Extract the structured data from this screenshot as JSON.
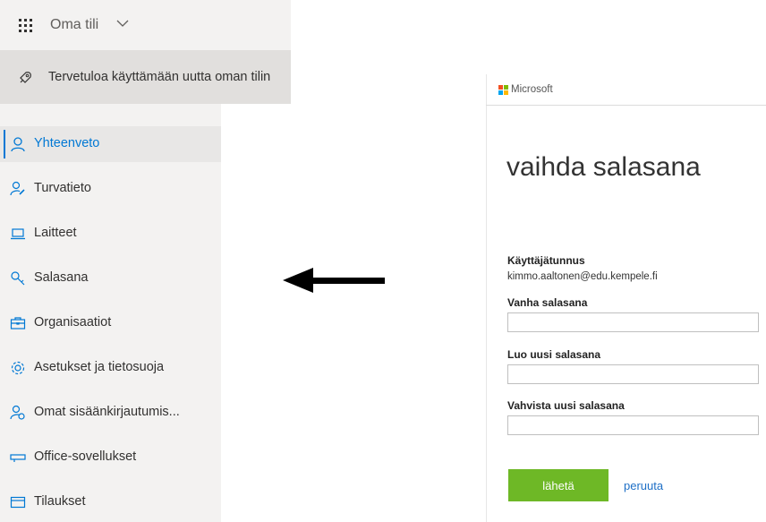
{
  "header": {
    "title": "Oma tili"
  },
  "banner": {
    "text": "Tervetuloa käyttämään uutta oman tilin"
  },
  "sidebar": {
    "items": [
      {
        "label": "Yhteenveto",
        "icon": "person-icon",
        "active": true
      },
      {
        "label": "Turvatieto",
        "icon": "person-key-icon"
      },
      {
        "label": "Laitteet",
        "icon": "laptop-icon"
      },
      {
        "label": "Salasana",
        "icon": "key-icon"
      },
      {
        "label": "Organisaatiot",
        "icon": "briefcase-icon"
      },
      {
        "label": "Asetukset ja tietosuoja",
        "icon": "gear-icon"
      },
      {
        "label": "Omat sisäänkirjautumis...",
        "icon": "people-key-icon"
      },
      {
        "label": "Office-sovellukset",
        "icon": "apps-icon"
      },
      {
        "label": "Tilaukset",
        "icon": "card-icon"
      }
    ]
  },
  "dialog": {
    "brand": "Microsoft",
    "title": "vaihda salasana",
    "username_label": "Käyttäjätunnus",
    "username_value": "kimmo.aaltonen@edu.kempele.fi",
    "old_password_label": "Vanha salasana",
    "new_password_label": "Luo uusi salasana",
    "confirm_password_label": "Vahvista uusi salasana",
    "submit_label": "lähetä",
    "cancel_label": "peruuta"
  },
  "colors": {
    "accent": "#0078d4",
    "submit": "#6eb826",
    "link": "#1e6fc6"
  }
}
